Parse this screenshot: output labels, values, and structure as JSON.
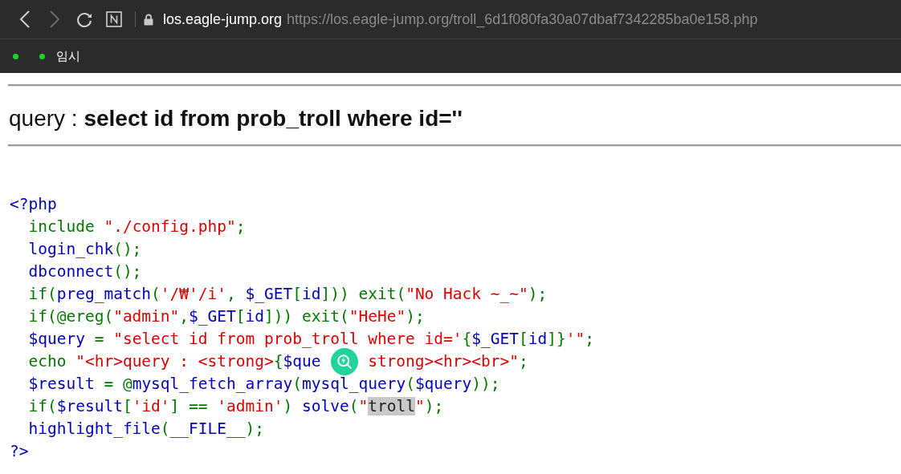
{
  "browser": {
    "back": {
      "disabled": false
    },
    "forward": {
      "disabled": true
    },
    "address": {
      "domain": "los.eagle-jump.org",
      "url": "https://los.eagle-jump.org/troll_6d1f080fa30a07dbaf7342285ba0e158.php"
    },
    "bookmarks": [
      {
        "kind": "icon"
      },
      {
        "kind": "labeled",
        "label": "임시"
      }
    ]
  },
  "query": {
    "label": "query :",
    "value": "select id from prob_troll where id=''"
  },
  "code": [
    {
      "tokens": [
        {
          "kind": "default",
          "text": "<?php"
        }
      ]
    },
    {
      "tokens": [
        {
          "kind": "keyword",
          "text": "  include "
        },
        {
          "kind": "string",
          "text": "\"./config.php\""
        },
        {
          "kind": "keyword",
          "text": ";"
        }
      ]
    },
    {
      "tokens": [
        {
          "kind": "default",
          "text": "  login_chk"
        },
        {
          "kind": "keyword",
          "text": "();"
        }
      ]
    },
    {
      "tokens": [
        {
          "kind": "default",
          "text": "  dbconnect"
        },
        {
          "kind": "keyword",
          "text": "();"
        }
      ]
    },
    {
      "tokens": [
        {
          "kind": "keyword",
          "text": "  if("
        },
        {
          "kind": "default",
          "text": "preg_match"
        },
        {
          "kind": "keyword",
          "text": "("
        },
        {
          "kind": "string",
          "text": "'/₩'/i'"
        },
        {
          "kind": "keyword",
          "text": ", "
        },
        {
          "kind": "default",
          "text": "$_GET"
        },
        {
          "kind": "keyword",
          "text": "["
        },
        {
          "kind": "default",
          "text": "id"
        },
        {
          "kind": "keyword",
          "text": "])) exit("
        },
        {
          "kind": "string",
          "text": "\"No Hack ~_~\""
        },
        {
          "kind": "keyword",
          "text": ");"
        }
      ]
    },
    {
      "tokens": [
        {
          "kind": "keyword",
          "text": "  if(@ereg("
        },
        {
          "kind": "string",
          "text": "\"admin\""
        },
        {
          "kind": "keyword",
          "text": ","
        },
        {
          "kind": "default",
          "text": "$_GET"
        },
        {
          "kind": "keyword",
          "text": "["
        },
        {
          "kind": "default",
          "text": "id"
        },
        {
          "kind": "keyword",
          "text": "])) exit("
        },
        {
          "kind": "string",
          "text": "\"HeHe\""
        },
        {
          "kind": "keyword",
          "text": ");"
        }
      ]
    },
    {
      "tokens": [
        {
          "kind": "default",
          "text": "  $query"
        },
        {
          "kind": "keyword",
          "text": " = "
        },
        {
          "kind": "string",
          "text": "\"select id from prob_troll where id='"
        },
        {
          "kind": "keyword",
          "text": "{"
        },
        {
          "kind": "default",
          "text": "$_GET"
        },
        {
          "kind": "keyword",
          "text": "["
        },
        {
          "kind": "default",
          "text": "id"
        },
        {
          "kind": "keyword",
          "text": "]}"
        },
        {
          "kind": "string",
          "text": "'\""
        },
        {
          "kind": "keyword",
          "text": ";"
        }
      ]
    },
    {
      "tokens": [
        {
          "kind": "keyword",
          "text": "  echo "
        },
        {
          "kind": "string",
          "text": "\"<hr>query : <strong>"
        },
        {
          "kind": "keyword",
          "text": "{"
        },
        {
          "kind": "default",
          "text": "$que"
        },
        {
          "kind": "covered"
        },
        {
          "kind": "string",
          "text": "strong><hr><br>\""
        },
        {
          "kind": "keyword",
          "text": ";"
        }
      ]
    },
    {
      "tokens": [
        {
          "kind": "default",
          "text": "  $result"
        },
        {
          "kind": "keyword",
          "text": " = @"
        },
        {
          "kind": "default",
          "text": "mysql_fetch_array"
        },
        {
          "kind": "keyword",
          "text": "("
        },
        {
          "kind": "default",
          "text": "mysql_query"
        },
        {
          "kind": "keyword",
          "text": "("
        },
        {
          "kind": "default",
          "text": "$query"
        },
        {
          "kind": "keyword",
          "text": "));"
        }
      ]
    },
    {
      "tokens": [
        {
          "kind": "keyword",
          "text": "  if("
        },
        {
          "kind": "default",
          "text": "$result"
        },
        {
          "kind": "keyword",
          "text": "["
        },
        {
          "kind": "string",
          "text": "'id'"
        },
        {
          "kind": "keyword",
          "text": "] == "
        },
        {
          "kind": "string",
          "text": "'admin'"
        },
        {
          "kind": "keyword",
          "text": ") "
        },
        {
          "kind": "default",
          "text": "solve"
        },
        {
          "kind": "keyword",
          "text": "("
        },
        {
          "kind": "string",
          "text": "\""
        },
        {
          "kind": "found",
          "text": "troll"
        },
        {
          "kind": "string",
          "text": "\""
        },
        {
          "kind": "keyword",
          "text": ");"
        }
      ]
    },
    {
      "tokens": [
        {
          "kind": "default",
          "text": "  highlight_file"
        },
        {
          "kind": "keyword",
          "text": "("
        },
        {
          "kind": "default",
          "text": "__FILE__"
        },
        {
          "kind": "keyword",
          "text": ");"
        }
      ]
    },
    {
      "tokens": [
        {
          "kind": "default",
          "text": "?>"
        }
      ]
    }
  ]
}
